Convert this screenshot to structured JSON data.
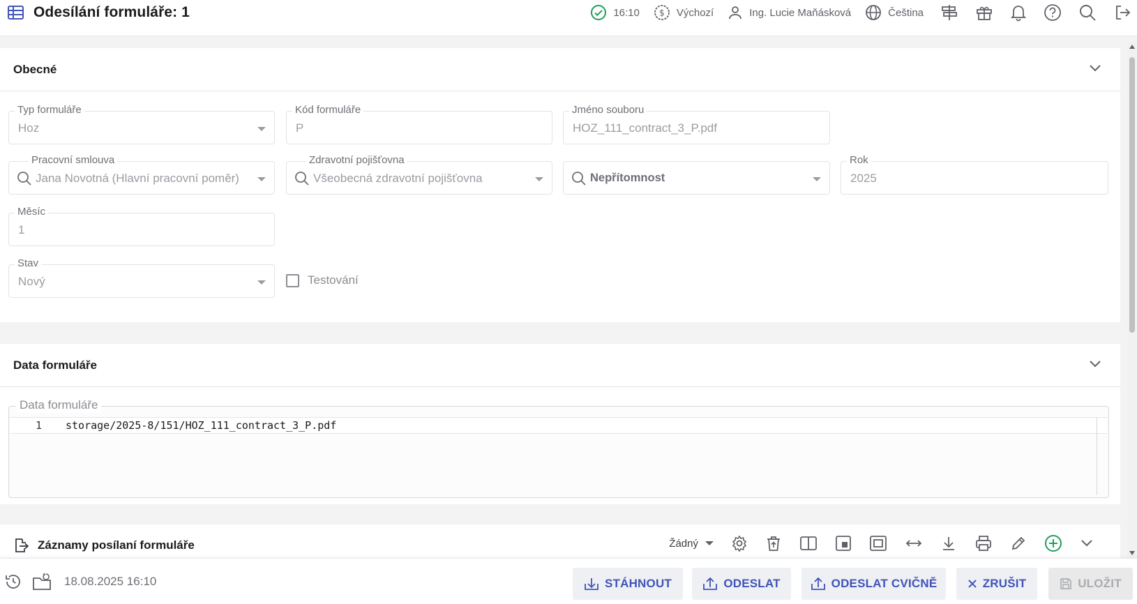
{
  "header": {
    "title": "Odesílání formuláře: 1",
    "time": "16:10",
    "currency": "Výchozí",
    "user": "Ing. Lucie Maňásková",
    "language": "Čeština"
  },
  "general": {
    "heading": "Obecné",
    "fields": {
      "typ_formulare": {
        "label": "Typ formuláře",
        "value": "Hoz"
      },
      "kod_formulare": {
        "label": "Kód formuláře",
        "value": "P"
      },
      "jmeno_souboru": {
        "label": "Jméno souboru",
        "value": "HOZ_111_contract_3_P.pdf"
      },
      "pracovni_smlouva": {
        "label": "Pracovní smlouva",
        "value": "Jana Novotná (Hlavní pracovní poměr)"
      },
      "zdravotni_pojistovna": {
        "label": "Zdravotní pojišťovna",
        "value": "Všeobecná zdravotní pojišťovna"
      },
      "nepritomnost": {
        "label": "",
        "value": "Nepřítomnost"
      },
      "rok": {
        "label": "Rok",
        "value": "2025"
      },
      "mesic": {
        "label": "Měsíc",
        "value": "1"
      },
      "stav": {
        "label": "Stav",
        "value": "Nový"
      },
      "testovani": {
        "label": "Testování",
        "checked": false
      }
    }
  },
  "form_data": {
    "heading": "Data formuláře",
    "editor_label": "Data formuláře",
    "line_number": "1",
    "line_text": "storage/2025-8/151/HOZ_111_contract_3_P.pdf"
  },
  "records": {
    "heading": "Záznamy posílaní formuláře",
    "filter_value": "Žádný"
  },
  "footer": {
    "timestamp": "18.08.2025 16:10",
    "buttons": {
      "download": "STÁHNOUT",
      "send": "ODESLAT",
      "send_test": "ODESLAT CVIČNĚ",
      "cancel": "ZRUŠIT",
      "save": "ULOŽIT"
    }
  },
  "colors": {
    "accent": "#4053b8",
    "success": "#1e9e5a",
    "add": "#1e9e5a"
  }
}
